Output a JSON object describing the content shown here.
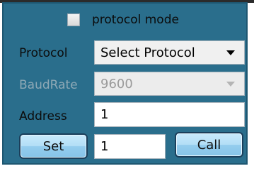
{
  "protocol_mode": {
    "label": "protocol mode",
    "checked": false
  },
  "protocol": {
    "label": "Protocol",
    "selected": "Select Protocol"
  },
  "baudrate": {
    "label": "BaudRate",
    "selected": "9600",
    "enabled": false
  },
  "address": {
    "label": "Address",
    "value": "1"
  },
  "actions": {
    "set_label": "Set",
    "value": "1",
    "call_label": "Call"
  },
  "colors": {
    "panel": "#2a6e8c",
    "button": "#a8daf4",
    "disabled_text": "#8ea9b6"
  }
}
